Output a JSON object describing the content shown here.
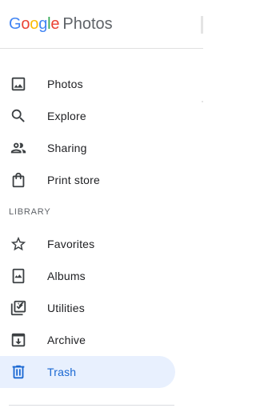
{
  "header": {
    "logo_letters": [
      {
        "char": "G",
        "color": "#4285f4"
      },
      {
        "char": "o",
        "color": "#ea4335"
      },
      {
        "char": "o",
        "color": "#fbbc05"
      },
      {
        "char": "g",
        "color": "#4285f4"
      },
      {
        "char": "l",
        "color": "#34a853"
      },
      {
        "char": "e",
        "color": "#ea4335"
      }
    ],
    "product_name": "Photos"
  },
  "nav": {
    "items": [
      {
        "label": "Photos",
        "icon": "photo-icon",
        "selected": false
      },
      {
        "label": "Explore",
        "icon": "search-icon",
        "selected": false
      },
      {
        "label": "Sharing",
        "icon": "people-icon",
        "selected": false
      },
      {
        "label": "Print store",
        "icon": "shopping-bag-icon",
        "selected": false
      }
    ]
  },
  "library": {
    "section_label": "LIBRARY",
    "items": [
      {
        "label": "Favorites",
        "icon": "star-icon",
        "selected": false
      },
      {
        "label": "Albums",
        "icon": "album-icon",
        "selected": false
      },
      {
        "label": "Utilities",
        "icon": "utilities-icon",
        "selected": false
      },
      {
        "label": "Archive",
        "icon": "archive-icon",
        "selected": false
      },
      {
        "label": "Trash",
        "icon": "trash-icon",
        "selected": true
      }
    ]
  },
  "colors": {
    "selected_background": "#e8f0fe",
    "selected_text": "#1967d2",
    "icon_default": "#3c4043"
  }
}
